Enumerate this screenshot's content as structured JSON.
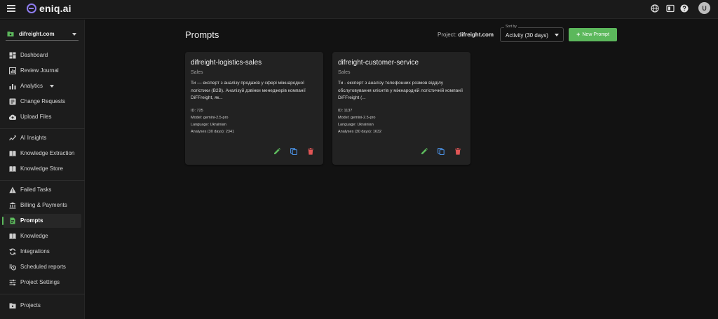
{
  "app": {
    "brand": "eniq.ai",
    "avatar_initial": "U",
    "accent": "#5cb85c"
  },
  "sidebar": {
    "project": "difreight.com",
    "items": [
      {
        "label": "Dashboard",
        "icon": "dashboard-icon"
      },
      {
        "label": "Review Journal",
        "icon": "journal-icon"
      },
      {
        "label": "Analytics",
        "icon": "analytics-icon"
      },
      {
        "label": "Change Requests",
        "icon": "change-requests-icon"
      },
      {
        "label": "Upload Files",
        "icon": "upload-icon"
      },
      {
        "label": "AI Insights",
        "icon": "insights-icon"
      },
      {
        "label": "Knowledge Extraction",
        "icon": "book-icon"
      },
      {
        "label": "Knowledge Store",
        "icon": "book-icon"
      },
      {
        "label": "Failed Tasks",
        "icon": "warning-icon"
      },
      {
        "label": "Billing & Payments",
        "icon": "bank-icon"
      },
      {
        "label": "Prompts",
        "icon": "prompt-doc-icon"
      },
      {
        "label": "Knowledge",
        "icon": "book-icon"
      },
      {
        "label": "Integrations",
        "icon": "sync-icon"
      },
      {
        "label": "Scheduled reports",
        "icon": "schedule-icon"
      },
      {
        "label": "Project Settings",
        "icon": "tune-icon"
      },
      {
        "label": "Projects",
        "icon": "folder-icon"
      }
    ]
  },
  "main": {
    "title": "Prompts",
    "project_label": "Project:",
    "project_name": "difreight.com",
    "sort_legend": "Sort by",
    "sort_value": "Activity (30 days)",
    "new_prompt_label": "New Prompt",
    "cards": [
      {
        "title": "difreight-logistics-sales",
        "category": "Sales",
        "description": "Ти — експерт з аналізу продажів у сфері міжнародної логістики (B2B). Аналізуй дзвінки менеджерів компанії DiFFreight, як...",
        "id": "ID: 725",
        "model": "Model: gemini-2.5-pro",
        "language": "Language: Ukrainian",
        "analyses": "Analyses (30 days): 2341"
      },
      {
        "title": "difreight-customer-service",
        "category": "Sales",
        "description": "Ти - експерт з аналізу телефонних розмов відділу обслуговування клієнтів у міжнародній логістичній компанії DiFFreight (...",
        "id": "ID: 1137",
        "model": "Model: gemini-2.5-pro",
        "language": "Language: Ukrainian",
        "analyses": "Analyses (30 days): 1632"
      }
    ]
  }
}
